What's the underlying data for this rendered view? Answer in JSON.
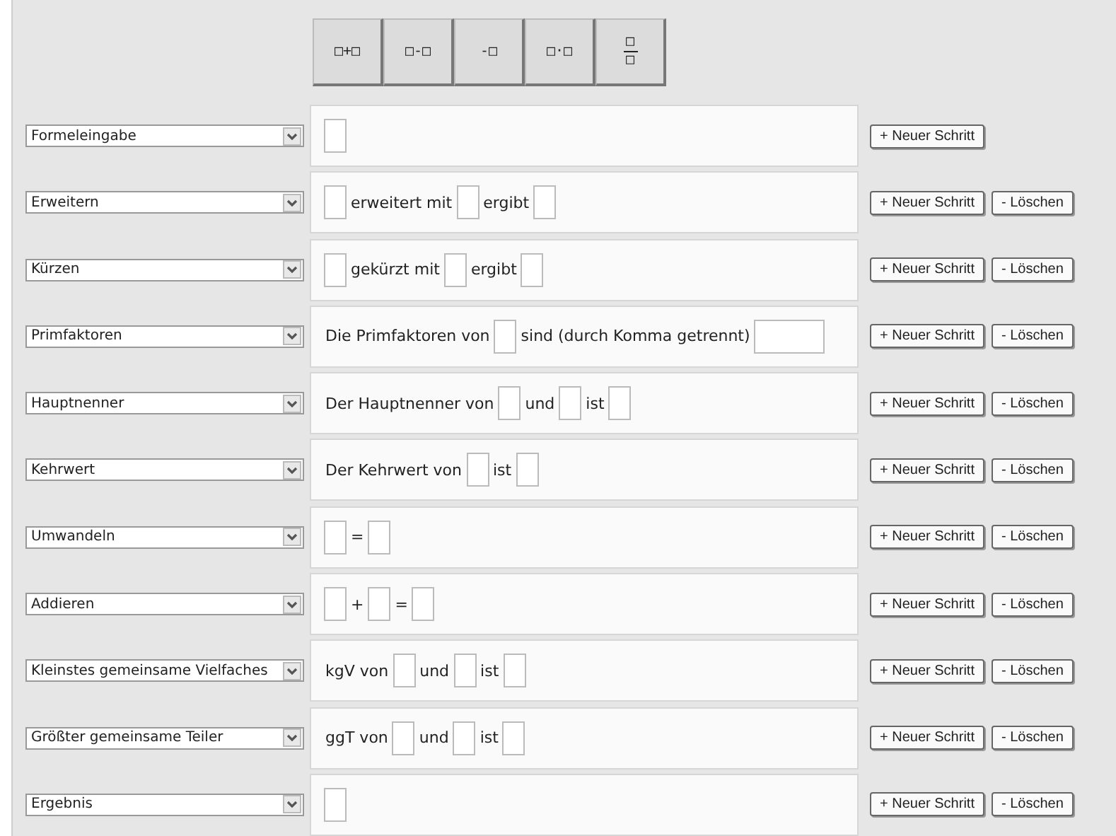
{
  "toolbar": [
    {
      "kind": "binary",
      "left": "□",
      "op": "+",
      "right": "□"
    },
    {
      "kind": "binary",
      "left": "□",
      "op": "-",
      "right": "□"
    },
    {
      "kind": "unary",
      "op": "-",
      "right": "□"
    },
    {
      "kind": "binary",
      "left": "□",
      "op": "·",
      "right": "□"
    },
    {
      "kind": "fraction",
      "top": "□",
      "bottom": "□"
    }
  ],
  "steps": [
    {
      "type": "Formeleingabe",
      "parts": [
        {
          "kind": "box"
        }
      ],
      "new_step": "+ Neuer Schritt"
    },
    {
      "type": "Erweitern",
      "parts": [
        {
          "kind": "box"
        },
        {
          "kind": "text",
          "text": "erweitert mit"
        },
        {
          "kind": "box"
        },
        {
          "kind": "text",
          "text": "ergibt"
        },
        {
          "kind": "box"
        }
      ],
      "new_step": "+ Neuer Schritt",
      "delete": "- Löschen"
    },
    {
      "type": "Kürzen",
      "parts": [
        {
          "kind": "box"
        },
        {
          "kind": "text",
          "text": "gekürzt mit"
        },
        {
          "kind": "box"
        },
        {
          "kind": "text",
          "text": "ergibt"
        },
        {
          "kind": "box"
        }
      ],
      "new_step": "+ Neuer Schritt",
      "delete": "- Löschen"
    },
    {
      "type": "Primfaktoren",
      "parts": [
        {
          "kind": "text",
          "text": "Die Primfaktoren von"
        },
        {
          "kind": "box"
        },
        {
          "kind": "text",
          "text": "sind (durch Komma getrennt)"
        },
        {
          "kind": "wide"
        }
      ],
      "new_step": "+ Neuer Schritt",
      "delete": "- Löschen"
    },
    {
      "type": "Hauptnenner",
      "parts": [
        {
          "kind": "text",
          "text": "Der Hauptnenner von"
        },
        {
          "kind": "box"
        },
        {
          "kind": "text",
          "text": "und"
        },
        {
          "kind": "box"
        },
        {
          "kind": "text",
          "text": "ist"
        },
        {
          "kind": "box"
        }
      ],
      "new_step": "+ Neuer Schritt",
      "delete": "- Löschen"
    },
    {
      "type": "Kehrwert",
      "parts": [
        {
          "kind": "text",
          "text": "Der Kehrwert von"
        },
        {
          "kind": "box"
        },
        {
          "kind": "text",
          "text": "ist"
        },
        {
          "kind": "box"
        }
      ],
      "new_step": "+ Neuer Schritt",
      "delete": "- Löschen"
    },
    {
      "type": "Umwandeln",
      "parts": [
        {
          "kind": "box"
        },
        {
          "kind": "text",
          "text": "="
        },
        {
          "kind": "box"
        }
      ],
      "new_step": "+ Neuer Schritt",
      "delete": "- Löschen"
    },
    {
      "type": "Addieren",
      "parts": [
        {
          "kind": "box"
        },
        {
          "kind": "text",
          "text": "+"
        },
        {
          "kind": "box"
        },
        {
          "kind": "text",
          "text": "="
        },
        {
          "kind": "box"
        }
      ],
      "new_step": "+ Neuer Schritt",
      "delete": "- Löschen"
    },
    {
      "type": "Kleinstes gemeinsame Vielfaches",
      "parts": [
        {
          "kind": "text",
          "text": "kgV von"
        },
        {
          "kind": "box"
        },
        {
          "kind": "text",
          "text": "und"
        },
        {
          "kind": "box"
        },
        {
          "kind": "text",
          "text": "ist"
        },
        {
          "kind": "box"
        }
      ],
      "new_step": "+ Neuer Schritt",
      "delete": "- Löschen"
    },
    {
      "type": "Größter gemeinsame Teiler",
      "parts": [
        {
          "kind": "text",
          "text": "ggT von"
        },
        {
          "kind": "box"
        },
        {
          "kind": "text",
          "text": "und"
        },
        {
          "kind": "box"
        },
        {
          "kind": "text",
          "text": "ist"
        },
        {
          "kind": "box"
        }
      ],
      "new_step": "+ Neuer Schritt",
      "delete": "- Löschen"
    },
    {
      "type": "Ergebnis",
      "parts": [
        {
          "kind": "box"
        }
      ],
      "new_step": "+ Neuer Schritt",
      "delete": "- Löschen"
    }
  ]
}
